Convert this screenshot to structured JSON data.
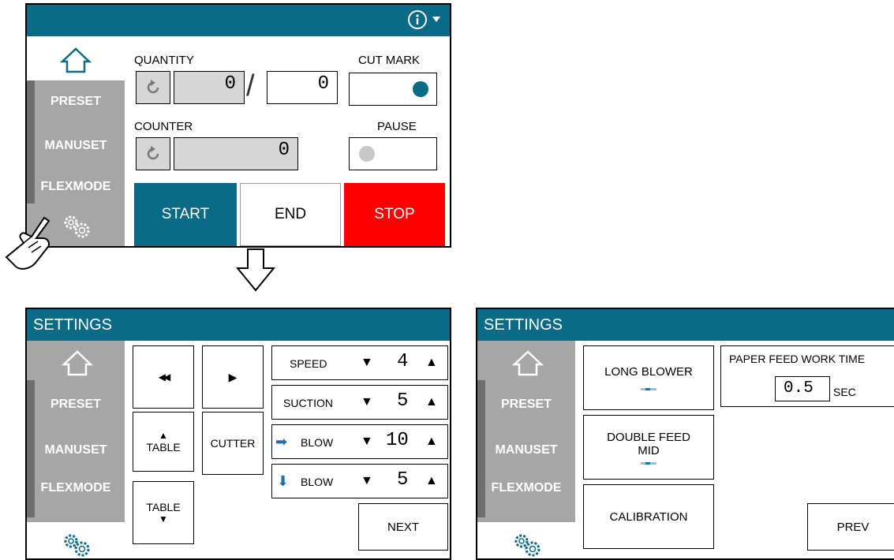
{
  "colors": {
    "bar": "#0b6a86",
    "stop": "#ff0000",
    "start": "#0b6a86",
    "sidebar": "#a6a6a6",
    "dot_blue": "#0b6a86",
    "dot_gray": "#c8c8c8",
    "blow_arrow": "#1f6fad"
  },
  "top": {
    "info_icon": "info-circle-icon",
    "quantity_label": "QUANTITY",
    "quantity_value": "0",
    "quantity_total": "0",
    "separator": "/",
    "cut_mark_label": "CUT MARK",
    "counter_label": "COUNTER",
    "counter_value": "0",
    "pause_label": "PAUSE",
    "start_label": "START",
    "end_label": "END",
    "stop_label": "STOP"
  },
  "sidebar": {
    "items": [
      "PRESET",
      "MANUSET",
      "FLEXMODE"
    ]
  },
  "settings_left": {
    "title": "SETTINGS",
    "rewind_glyph": "◀◀",
    "play_glyph": "▶",
    "table_up_label": "TABLE",
    "cutter_label": "CUTTER",
    "table_down_label": "TABLE",
    "params": [
      {
        "label": "SPEED",
        "value": "4",
        "arrow": ""
      },
      {
        "label": "SUCTION",
        "value": "5",
        "arrow": ""
      },
      {
        "label": "BLOW",
        "value": "10",
        "arrow": "➡"
      },
      {
        "label": "BLOW",
        "value": "5",
        "arrow": "⬇"
      }
    ],
    "down_glyph": "▼",
    "up_glyph": "▲",
    "next_label": "NEXT"
  },
  "settings_right": {
    "title": "SETTINGS",
    "long_blower_label": "LONG BLOWER",
    "double_feed_label_1": "DOUBLE FEED",
    "double_feed_label_2": "MID",
    "calibration_label": "CALIBRATION",
    "paper_feed_label": "PAPER FEED WORK TIME",
    "paper_feed_value": "0.5",
    "paper_feed_unit": "SEC",
    "prev_label": "PREV"
  }
}
